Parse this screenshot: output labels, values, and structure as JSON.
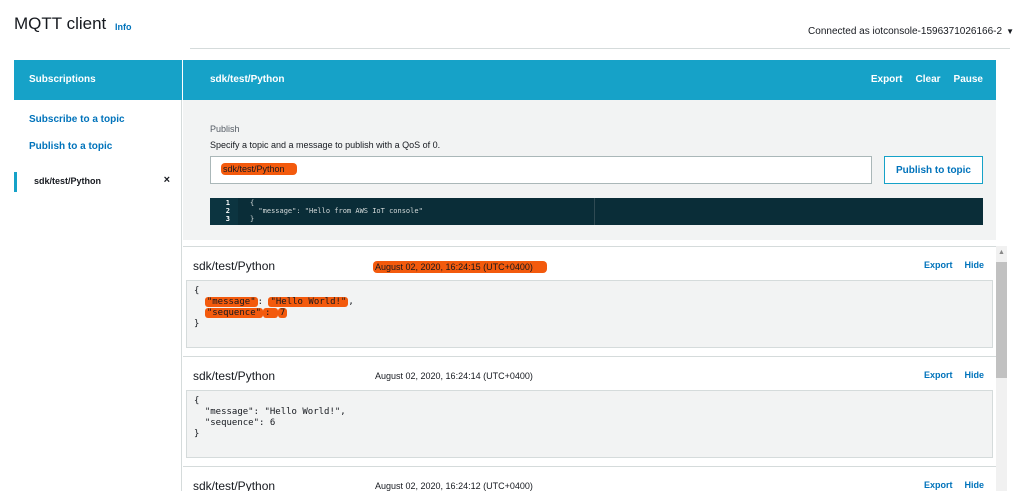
{
  "header": {
    "title": "MQTT client",
    "info": "Info",
    "connection": "Connected as iotconsole-1596371026166-2",
    "caret_icon": "triangle-down"
  },
  "sidebar": {
    "heading": "Subscriptions",
    "subscribe_link": "Subscribe to a topic",
    "publish_link": "Publish to a topic",
    "subscription": "sdk/test/Python",
    "close_icon": "×"
  },
  "topic_bar": {
    "name": "sdk/test/Python",
    "actions": [
      "Export",
      "Clear",
      "Pause"
    ]
  },
  "publish": {
    "title": "Publish",
    "description": "Specify a topic and a message to publish with a QoS of 0.",
    "topic_value": "sdk/test/Python",
    "button": "Publish to topic",
    "editor": {
      "lines": [
        {
          "num": "1",
          "code": "{"
        },
        {
          "num": "2",
          "code": "  \"message\": \"Hello from AWS IoT console\""
        },
        {
          "num": "3",
          "code": "}"
        }
      ]
    }
  },
  "messages": [
    {
      "topic": "sdk/test/Python",
      "time": "August 02, 2020, 16:24:15 (UTC+0400)",
      "export": "Export",
      "hide": "Hide",
      "open": "{",
      "line1_key": "\"message\"",
      "line1_sep": ": ",
      "line1_val": "\"Hello World!\"",
      "line1_end": ",",
      "line2_key": "\"sequence\"",
      "line2_sep": ": ",
      "line2_val": "7",
      "close": "}"
    },
    {
      "topic": "sdk/test/Python",
      "time": "August 02, 2020, 16:24:14 (UTC+0400)",
      "export": "Export",
      "hide": "Hide",
      "body": "{\n  \"message\": \"Hello World!\",\n  \"sequence\": 6\n}"
    },
    {
      "topic": "sdk/test/Python",
      "time": "August 02, 2020, 16:24:12 (UTC+0400)",
      "export": "Export",
      "hide": "Hide"
    }
  ],
  "colors": {
    "accent": "#16a2c8",
    "link": "#0073bb",
    "highlight": "#f35a0d",
    "editor_bg": "#0a2d38"
  }
}
